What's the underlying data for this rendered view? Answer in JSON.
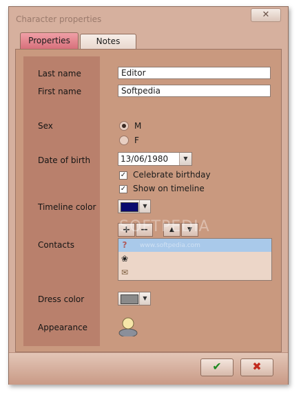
{
  "window": {
    "title": "Character properties",
    "close_glyph": "✕"
  },
  "tabs": [
    {
      "label": "Properties"
    },
    {
      "label": "Notes"
    }
  ],
  "labels": {
    "last_name": "Last name",
    "first_name": "First name",
    "sex": "Sex",
    "date_of_birth": "Date of birth",
    "timeline_color": "Timeline color",
    "contacts": "Contacts",
    "dress_color": "Dress color",
    "appearance": "Appearance"
  },
  "fields": {
    "last_name": "Editor",
    "first_name": "Softpedia"
  },
  "sex": {
    "options": [
      "M",
      "F"
    ],
    "selected": "M"
  },
  "birth": {
    "date": "13/06/1980",
    "celebrate_label": "Celebrate birthday",
    "celebrate_checked": true,
    "timeline_label": "Show on timeline",
    "timeline_checked": true
  },
  "colors": {
    "timeline": "#0a0a6e",
    "dress": "#8a8a8a"
  },
  "contacts_toolbar": {
    "add": "+",
    "remove": "−",
    "up": "▲",
    "down": "▼"
  },
  "contacts": [
    {
      "icon": "question-icon",
      "glyph": "?",
      "selected": true
    },
    {
      "icon": "flower-icon",
      "glyph": "❀",
      "selected": false
    },
    {
      "icon": "envelope-icon",
      "glyph": "✉",
      "selected": false
    }
  ],
  "dialog_buttons": {
    "ok_glyph": "✔",
    "cancel_glyph": "✖"
  },
  "watermark": {
    "main": "SOFTPEDIA",
    "url": "www.softpedia.com"
  }
}
